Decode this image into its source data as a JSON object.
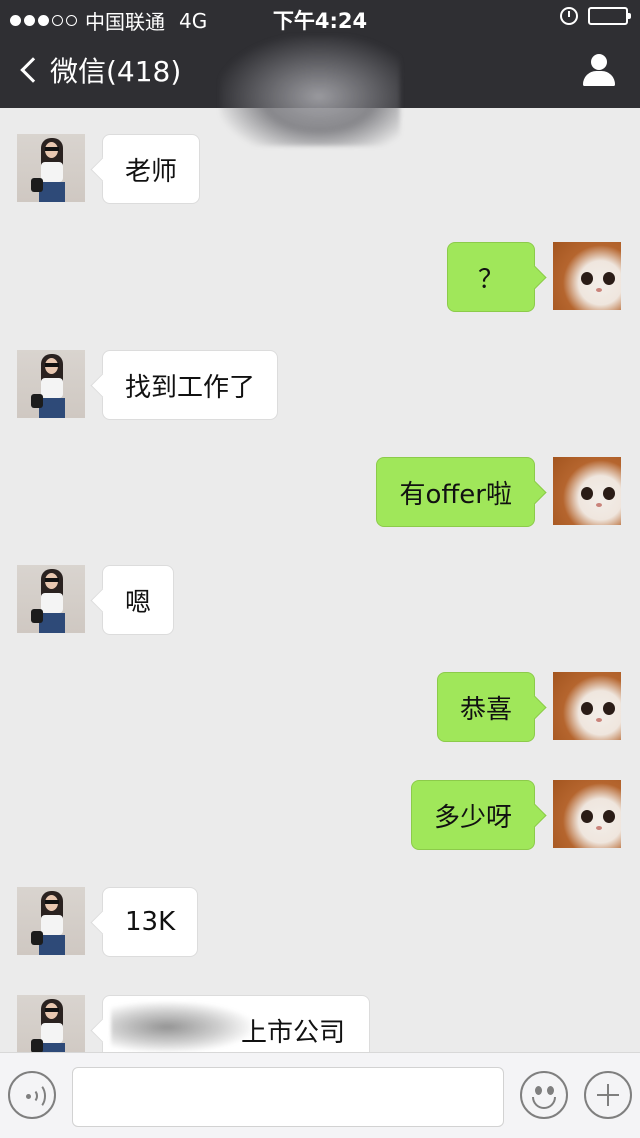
{
  "status_bar": {
    "carrier": "中国联通",
    "network": "4G",
    "time": "下午4:24",
    "signal_dots_filled": 3,
    "signal_dots_total": 5
  },
  "nav": {
    "back_label": "微信(418)",
    "title_text": "张"
  },
  "messages": [
    {
      "side": "in",
      "text": "老师"
    },
    {
      "side": "out",
      "text": "？"
    },
    {
      "side": "in",
      "text": "找到工作了"
    },
    {
      "side": "out",
      "text": "有offer啦"
    },
    {
      "side": "in",
      "text": "嗯"
    },
    {
      "side": "out",
      "text": "恭喜"
    },
    {
      "side": "out",
      "text": "多少呀"
    },
    {
      "side": "in",
      "text": "13K"
    },
    {
      "side": "in",
      "text": "上市公司"
    }
  ],
  "input_bar": {
    "value": "",
    "voice_icon": "voice-icon",
    "emoji_icon": "emoji-icon",
    "plus_icon": "plus-icon"
  },
  "colors": {
    "nav_bg": "#2f2f33",
    "chat_bg": "#ebebeb",
    "outgoing_bubble": "#a0e75a",
    "incoming_bubble": "#ffffff"
  }
}
